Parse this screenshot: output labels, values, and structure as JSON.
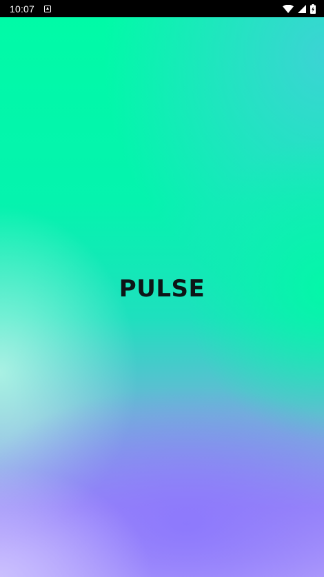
{
  "status_bar": {
    "time": "10:07",
    "icons": [
      "notification-a-icon",
      "wifi-icon",
      "cellular-signal-icon",
      "battery-charging-icon"
    ]
  },
  "splash": {
    "brand": "PULSE"
  },
  "colors": {
    "status_bar_bg": "#000000",
    "mint": "#00f5a8",
    "teal": "#46cddc",
    "lavender": "#8c78fc",
    "brand_text": "#0d1517"
  }
}
